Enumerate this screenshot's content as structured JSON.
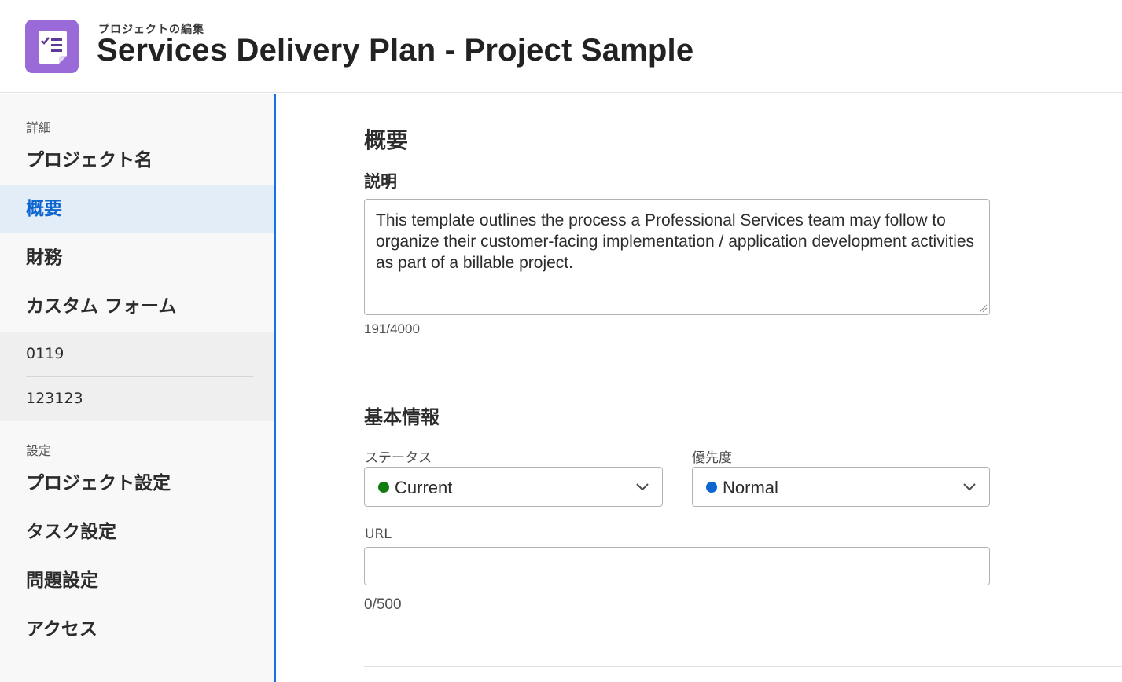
{
  "header": {
    "subtitle": "プロジェクトの編集",
    "title": "Services Delivery Plan - Project Sample",
    "icon": "project-checklist-icon",
    "icon_color": "#9b6ad9"
  },
  "sidebar": {
    "details_label": "詳細",
    "items_details": [
      {
        "label": "プロジェクト名"
      },
      {
        "label": "概要",
        "active": true
      },
      {
        "label": "財務"
      },
      {
        "label": "カスタム フォーム"
      }
    ],
    "custom_forms": [
      {
        "label": "0119"
      },
      {
        "label": "123123"
      }
    ],
    "settings_label": "設定",
    "items_settings": [
      {
        "label": "プロジェクト設定"
      },
      {
        "label": "タスク設定"
      },
      {
        "label": "問題設定"
      },
      {
        "label": "アクセス"
      }
    ],
    "accent_color": "#1473e6"
  },
  "overview": {
    "heading": "概要",
    "description_label": "説明",
    "description_value": "This template outlines the process a Professional Services team may follow to organize their customer-facing implementation / application development activities as part of a billable project.",
    "description_counter": "191/4000"
  },
  "basic_info": {
    "heading": "基本情報",
    "status_label": "ステータス",
    "status_value": "Current",
    "status_color": "#107c10",
    "priority_label": "優先度",
    "priority_value": "Normal",
    "priority_color": "#0d66d0",
    "url_label": "URL",
    "url_value": "",
    "url_counter": "0/500"
  }
}
